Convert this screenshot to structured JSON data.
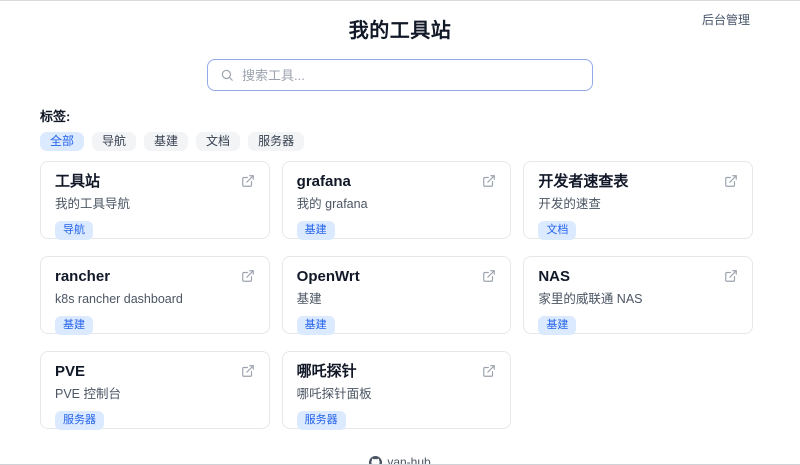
{
  "header": {
    "admin_link": "后台管理"
  },
  "title": "我的工具站",
  "search": {
    "placeholder": "搜索工具..."
  },
  "tags": {
    "label": "标签:",
    "items": [
      {
        "label": "全部",
        "active": true
      },
      {
        "label": "导航",
        "active": false
      },
      {
        "label": "基建",
        "active": false
      },
      {
        "label": "文档",
        "active": false
      },
      {
        "label": "服务器",
        "active": false
      }
    ]
  },
  "cards": [
    {
      "title": "工具站",
      "description": "我的工具导航",
      "tag": "导航"
    },
    {
      "title": "grafana",
      "description": "我的 grafana",
      "tag": "基建"
    },
    {
      "title": "开发者速查表",
      "description": "开发的速查",
      "tag": "文档"
    },
    {
      "title": "rancher",
      "description": "k8s rancher dashboard",
      "tag": "基建"
    },
    {
      "title": "OpenWrt",
      "description": "基建",
      "tag": "基建"
    },
    {
      "title": "NAS",
      "description": "家里的威联通 NAS",
      "tag": "基建"
    },
    {
      "title": "PVE",
      "description": "PVE 控制台",
      "tag": "服务器"
    },
    {
      "title": "哪吒探针",
      "description": "哪吒探针面板",
      "tag": "服务器"
    }
  ],
  "footer": {
    "brand": "van-hub"
  },
  "colors": {
    "accent": "#2563eb",
    "badge_bg": "#dbeafe",
    "pill_bg": "#f3f4f6",
    "search_border": "#94a9e8",
    "card_border": "#e5e7eb",
    "muted_text": "#4b5563"
  }
}
